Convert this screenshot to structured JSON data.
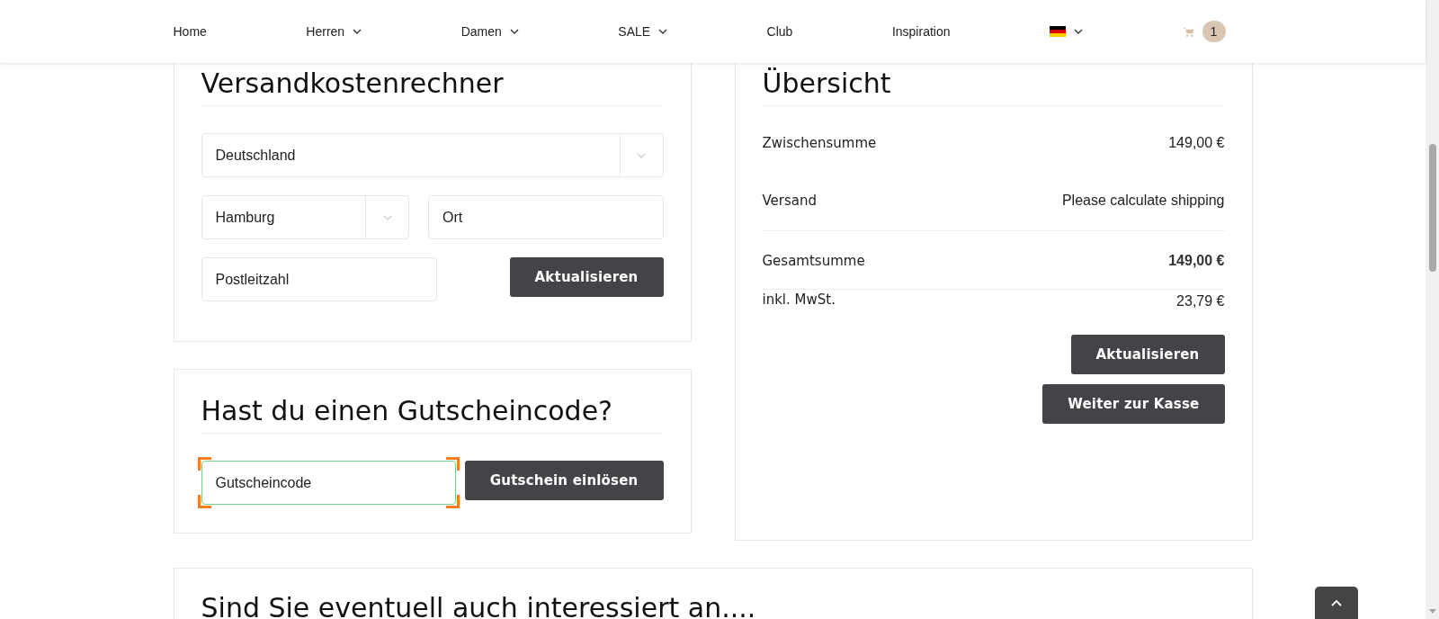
{
  "header": {
    "nav": [
      {
        "label": "Home",
        "has_menu": false
      },
      {
        "label": "Herren",
        "has_menu": true
      },
      {
        "label": "Damen",
        "has_menu": true
      },
      {
        "label": "SALE",
        "has_menu": true
      },
      {
        "label": "Club",
        "has_menu": false
      },
      {
        "label": "Inspiration",
        "has_menu": false
      }
    ],
    "language": {
      "has_menu": true
    },
    "cart": {
      "count": "1"
    }
  },
  "shipping_calculator": {
    "title": "Versandkostenrechner",
    "country": {
      "value": "Deutschland"
    },
    "state": {
      "value": "Hamburg"
    },
    "city": {
      "placeholder": "Ort"
    },
    "postcode": {
      "placeholder": "Postleitzahl"
    },
    "button": "Aktualisieren"
  },
  "coupon": {
    "title": "Hast du einen Gutscheincode?",
    "field": {
      "placeholder": "Gutscheincode",
      "focused": true
    },
    "button": "Gutschein einlösen"
  },
  "summary": {
    "title": "Übersicht",
    "rows": [
      {
        "label": "Zwischensumme",
        "value": "149,00 €",
        "kind": "plain"
      },
      {
        "label": "Versand",
        "value": "Please calculate shipping",
        "kind": "plain"
      },
      {
        "label": "Gesamtsumme",
        "value": "149,00 €",
        "kind": "total"
      },
      {
        "label": "inkl. MwSt.",
        "value": "23,79 €",
        "kind": "tax"
      }
    ],
    "buttons": [
      "Aktualisieren",
      "Weiter zur Kasse"
    ]
  },
  "related": {
    "title": "Sind Sie eventuell auch interessiert an...."
  }
}
